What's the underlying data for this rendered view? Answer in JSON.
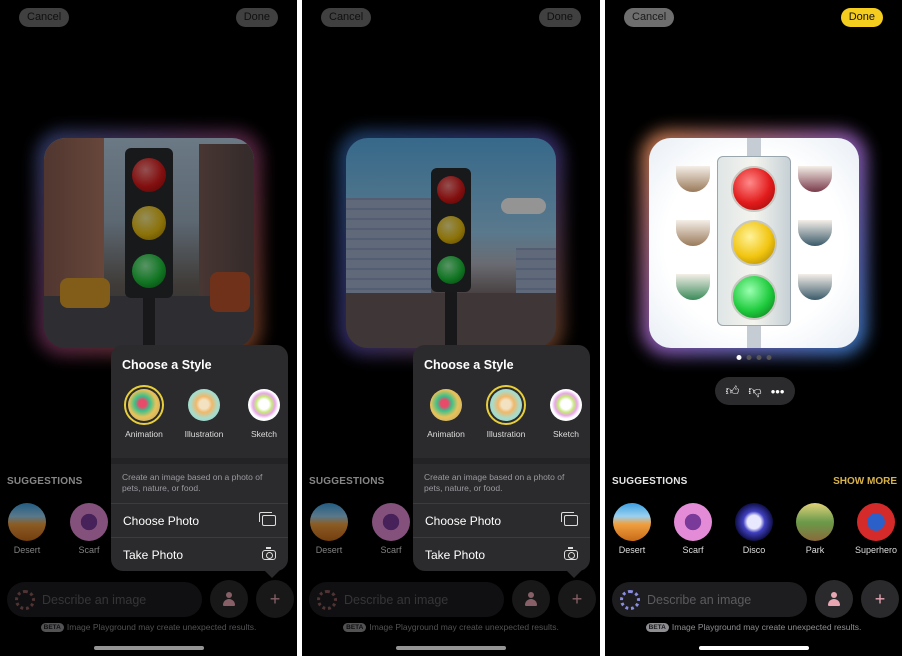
{
  "panels": [
    {
      "id": "panel-1",
      "cancel_label": "Cancel",
      "done_label": "Done",
      "image_style": "Animation",
      "popover": {
        "title": "Choose a Style",
        "styles": [
          {
            "label": "Animation",
            "selected": true
          },
          {
            "label": "Illustration",
            "selected": false
          },
          {
            "label": "Sketch",
            "selected": false
          }
        ],
        "description": "Create an image based on a photo of pets, nature, or food.",
        "actions": [
          {
            "label": "Choose Photo",
            "icon": "photos-icon"
          },
          {
            "label": "Take Photo",
            "icon": "camera-icon"
          }
        ]
      },
      "suggestions_title": "SUGGESTIONS",
      "suggestions": [
        {
          "label": "Desert"
        },
        {
          "label": "Scarf"
        }
      ]
    },
    {
      "id": "panel-2",
      "cancel_label": "Cancel",
      "done_label": "Done",
      "image_style": "Illustration",
      "popover": {
        "title": "Choose a Style",
        "styles": [
          {
            "label": "Animation",
            "selected": false
          },
          {
            "label": "Illustration",
            "selected": true
          },
          {
            "label": "Sketch",
            "selected": false
          }
        ],
        "description": "Create an image based on a photo of pets, nature, or food.",
        "actions": [
          {
            "label": "Choose Photo",
            "icon": "photos-icon"
          },
          {
            "label": "Take Photo",
            "icon": "camera-icon"
          }
        ]
      },
      "suggestions_title": "SUGGESTIONS",
      "suggestions": [
        {
          "label": "Desert"
        },
        {
          "label": "Scarf"
        }
      ]
    },
    {
      "id": "panel-3",
      "cancel_label": "Cancel",
      "done_label": "Done",
      "image_style": "Sketch",
      "pager": {
        "count": 4,
        "active": 1
      },
      "feedback": {
        "like": "thumbs-up-icon",
        "dislike": "thumbs-down-icon",
        "more": "more-icon",
        "more_glyph": "•••"
      },
      "suggestions_title": "SUGGESTIONS",
      "show_more_label": "SHOW MORE",
      "suggestions": [
        {
          "label": "Desert"
        },
        {
          "label": "Scarf"
        },
        {
          "label": "Disco"
        },
        {
          "label": "Park"
        },
        {
          "label": "Superhero"
        }
      ]
    }
  ],
  "input": {
    "placeholder": "Describe an image"
  },
  "plus_glyph": "+",
  "disclaimer": {
    "badge": "BETA",
    "text": "Image Playground may create unexpected results."
  },
  "colors": {
    "done_active": "#f5cd1e",
    "style_selected_ring": "#e8cf3a",
    "show_more": "#d8b24a"
  }
}
